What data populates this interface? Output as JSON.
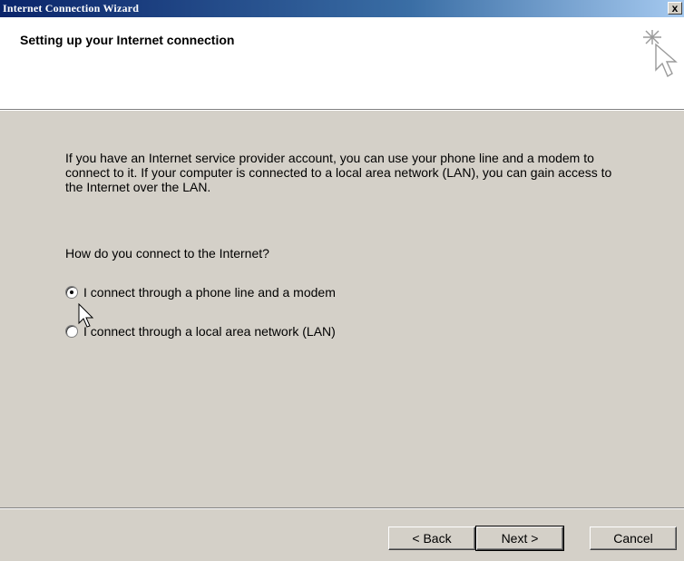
{
  "window": {
    "title": "Internet Connection Wizard",
    "close_label": "x"
  },
  "header": {
    "title": "Setting up your Internet connection",
    "icon": "wizard-sparkle-cursor-icon"
  },
  "main": {
    "description": "If you have an Internet service provider account, you can use your phone line and a modem to connect to it. If your computer is connected to a local area network (LAN), you can gain access to the Internet over the LAN.",
    "question": "How do you connect to the Internet?",
    "options": [
      {
        "label": "I connect through a phone line and a modem",
        "selected": true
      },
      {
        "label": "I connect through a local area network (LAN)",
        "selected": false
      }
    ]
  },
  "buttons": {
    "back": "< Back",
    "next": "Next >",
    "cancel": "Cancel"
  }
}
